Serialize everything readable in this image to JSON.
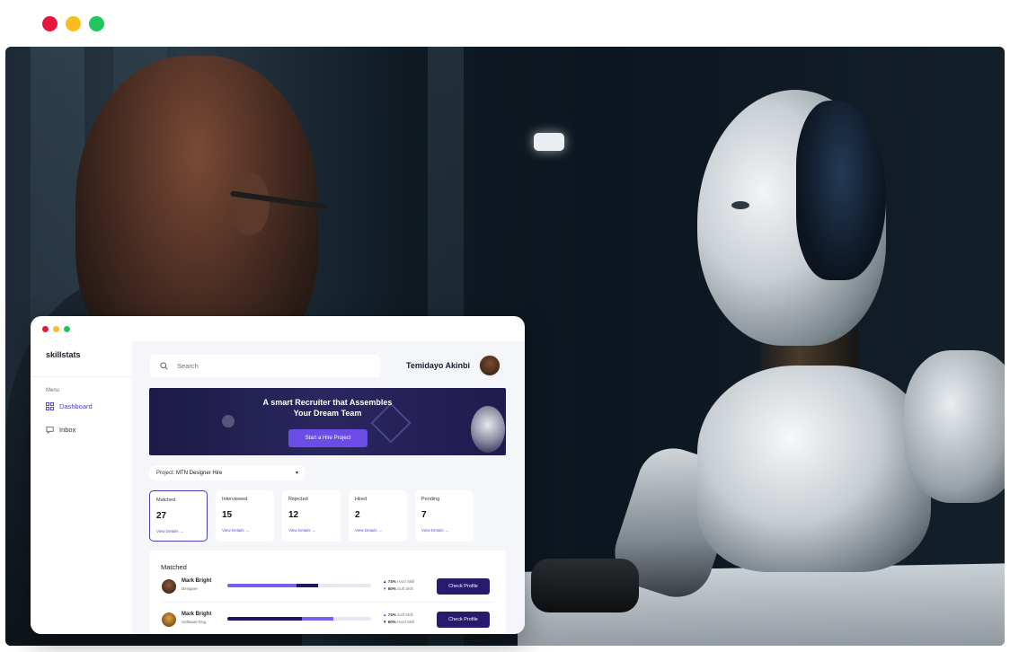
{
  "outer_window": {
    "dots": [
      {
        "color": "#e5173f"
      },
      {
        "color": "#fbbc24"
      },
      {
        "color": "#22c55e"
      }
    ]
  },
  "app": {
    "dots": [
      {
        "color": "#e5173f"
      },
      {
        "color": "#fbbc24"
      },
      {
        "color": "#22c55e"
      }
    ],
    "logo": "skillstats",
    "sidebar": {
      "menu_label": "Menu",
      "items": [
        {
          "label": "Dashboard",
          "icon": "dashboard-icon",
          "active": true
        },
        {
          "label": "Inbox",
          "icon": "inbox-icon",
          "active": false
        }
      ]
    },
    "header": {
      "search_placeholder": "Search",
      "user_name": "Temidayo Akinbi"
    },
    "banner": {
      "title_line1": "A smart Recruiter that Assembles",
      "title_line2": "Your Dream Team",
      "button_label": "Start a Hire Project"
    },
    "project": {
      "label": "Project:",
      "value": "MTN Designer Hire"
    },
    "stats": [
      {
        "label": "Matched",
        "value": "27",
        "link": "View Details",
        "active": true
      },
      {
        "label": "Interviewed",
        "value": "15",
        "link": "View Details",
        "active": false
      },
      {
        "label": "Rejected",
        "value": "12",
        "link": "View Details",
        "active": false
      },
      {
        "label": "Hired",
        "value": "2",
        "link": "View Details",
        "active": false
      },
      {
        "label": "Pending",
        "value": "7",
        "link": "View Details",
        "active": false
      }
    ],
    "matched": {
      "title": "Matched",
      "rows": [
        {
          "name": "Mark Bright",
          "role": "Designer",
          "hard_skill": "74%",
          "hard_label": "Hard Skill",
          "soft_skill": "60%",
          "soft_label": "Soft Skill",
          "button": "Check Profile"
        },
        {
          "name": "Mark Bright",
          "role": "Software Eng.",
          "hard_skill": "74%",
          "hard_label": "Soft Skill",
          "soft_skill": "60%",
          "soft_label": "Hard Skill",
          "button": "Check Profile"
        }
      ]
    },
    "colors": {
      "accent": "#6b4ce6",
      "button_dark": "#2a1a6e",
      "banner_bg": "#1c1a45"
    }
  }
}
